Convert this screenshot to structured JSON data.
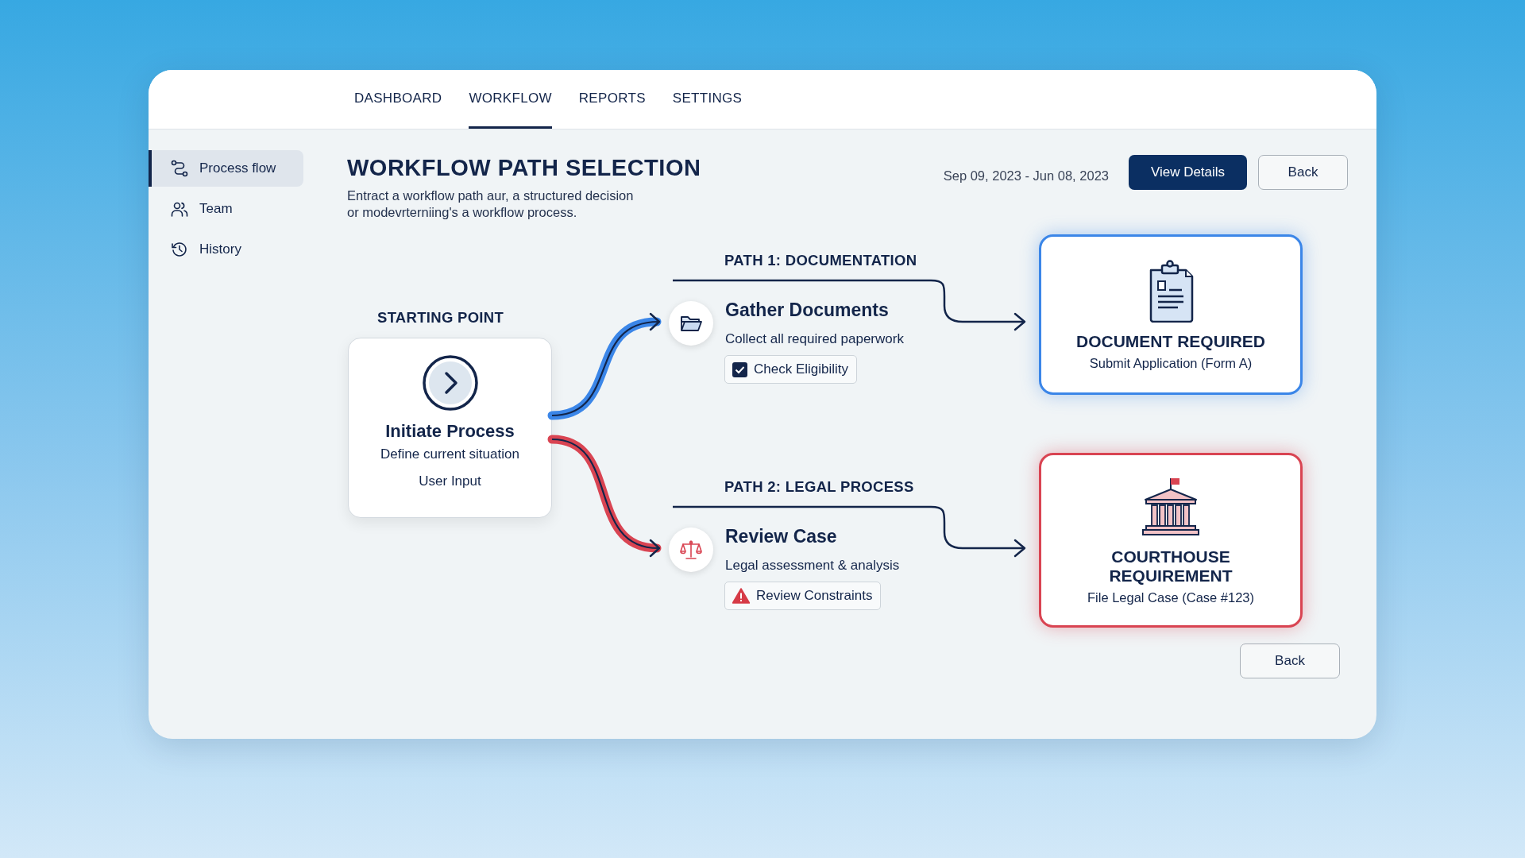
{
  "nav": {
    "tabs": [
      {
        "label": "DASHBOARD",
        "selected": false
      },
      {
        "label": "WORKFLOW",
        "selected": true
      },
      {
        "label": "REPORTS",
        "selected": false
      },
      {
        "label": "SETTINGS",
        "selected": false
      }
    ]
  },
  "sidebar": {
    "items": [
      {
        "label": "Process flow",
        "selected": true
      },
      {
        "label": "Team",
        "selected": false
      },
      {
        "label": "History",
        "selected": false
      }
    ]
  },
  "page": {
    "title": "WORKFLOW PATH SELECTION",
    "description": "Entract a workflow path aur, a structured decision\nor modevrterniing's a workflow process.",
    "date_range": "Sep 09, 2023 - Jun 08, 2023",
    "primary_button": "View Details",
    "secondary_button": "Back"
  },
  "diagram": {
    "start": {
      "heading": "STARTING POINT",
      "title": "Initiate Process",
      "subtitle": "Define current situation",
      "caption": "User Input"
    },
    "paths": [
      {
        "label": "PATH 1: DOCUMENTATION",
        "color": "#3b86e8",
        "step_title": "Gather Documents",
        "step_subtitle": "Collect all required paperwork",
        "chip": {
          "kind": "checkbox",
          "label": "Check Eligibility",
          "checked": true
        },
        "outcome": {
          "title": "DOCUMENT REQUIRED",
          "subtitle": "Submit Application (Form A)"
        }
      },
      {
        "label": "PATH 2: LEGAL PROCESS",
        "color": "#d94452",
        "step_title": "Review Case",
        "step_subtitle": "Legal assessment & analysis",
        "chip": {
          "kind": "warning",
          "label": "Review Constraints"
        },
        "outcome": {
          "title": "COURTHOUSE\nREQUIREMENT",
          "subtitle": "File Legal Case (Case #123)"
        }
      }
    ]
  },
  "footer": {
    "button": "Back"
  }
}
